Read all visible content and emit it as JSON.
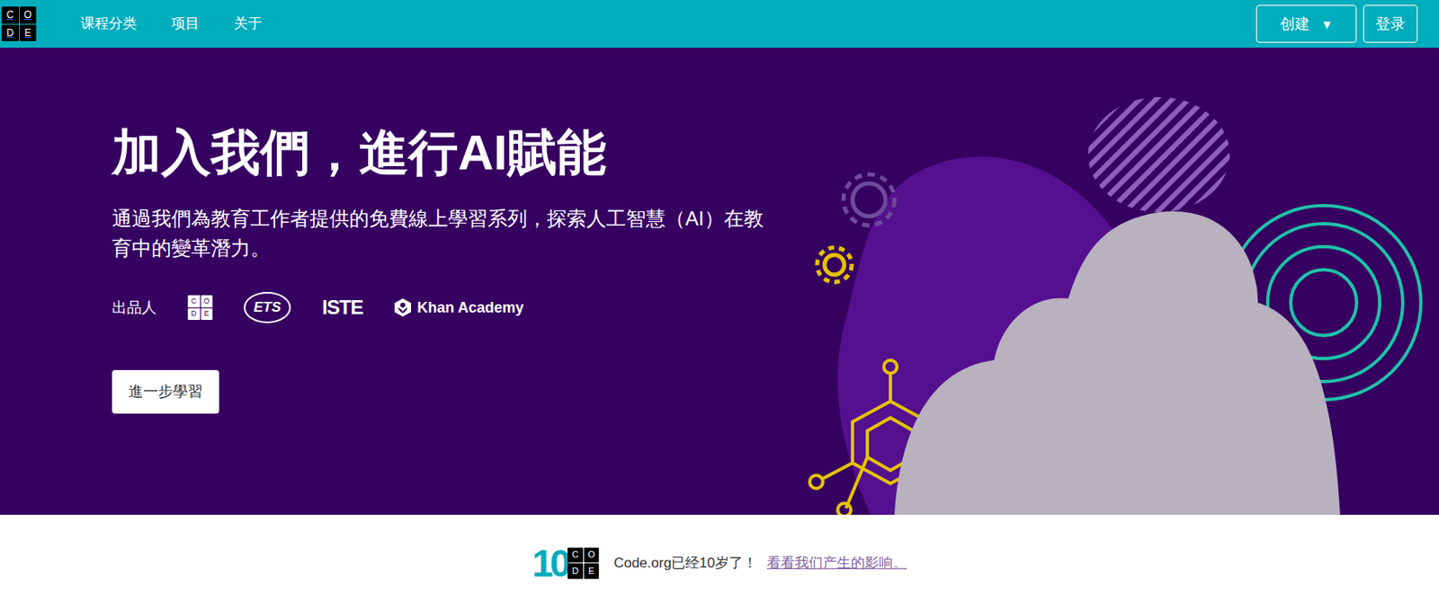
{
  "navbar": {
    "logo": [
      "C",
      "O",
      "D",
      "E"
    ],
    "items": [
      "课程分类",
      "项目",
      "关于"
    ],
    "create": {
      "label": "创建",
      "icon": "▼"
    },
    "login": "登录"
  },
  "hero": {
    "title": "加入我們，進行AI賦能",
    "subtitle": "通過我們為教育工作者提供的免費線上學習系列，探索人工智慧（AI）在教育中的變革潛力。",
    "presented_by": "出品人",
    "partners": [
      {
        "kind": "code",
        "letters": [
          "C",
          "O",
          "D",
          "E"
        ]
      },
      {
        "kind": "ets",
        "label": "ETS"
      },
      {
        "kind": "iste",
        "label": "ISTE"
      },
      {
        "kind": "khan",
        "label": "Khan Academy"
      }
    ],
    "button": "進一步學習"
  },
  "banner": {
    "badge_number": "10",
    "badge_letters": [
      "C",
      "O",
      "D",
      "E"
    ],
    "text": "Code.org已经10岁了！",
    "link": "看看我们产生的影响。"
  }
}
